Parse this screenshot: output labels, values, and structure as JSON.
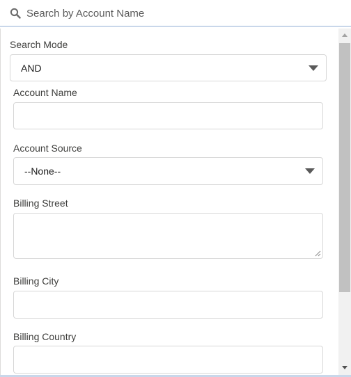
{
  "search": {
    "placeholder": "Search by Account Name",
    "value": ""
  },
  "form": {
    "search_mode": {
      "label": "Search Mode",
      "selected": "AND"
    },
    "account_name": {
      "label": "Account Name",
      "value": ""
    },
    "account_source": {
      "label": "Account Source",
      "selected": "--None--"
    },
    "billing_street": {
      "label": "Billing Street",
      "value": ""
    },
    "billing_city": {
      "label": "Billing City",
      "value": ""
    },
    "billing_country": {
      "label": "Billing Country",
      "value": ""
    }
  },
  "icons": {
    "search": "search-icon",
    "dropdown": "chevron-down-icon",
    "scroll_up": "scroll-up-arrow",
    "scroll_down": "scroll-down-arrow"
  },
  "colors": {
    "field_border": "#d7d7d7",
    "focus_line": "#c9d7ea",
    "label_text": "#3e3e3c",
    "scrollbar_thumb": "#c1c1c1"
  }
}
